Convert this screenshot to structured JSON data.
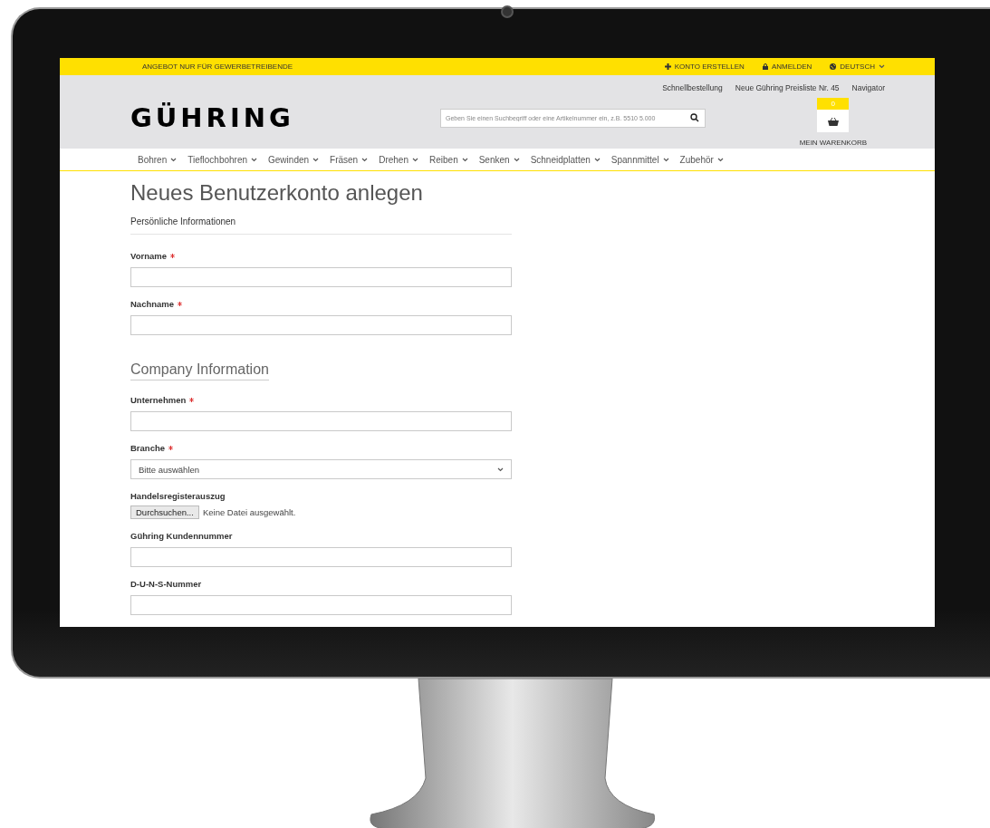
{
  "top_bar": {
    "notice": "ANGEBOT NUR FÜR GEWERBETREIBENDE",
    "links": [
      {
        "kind": "plus",
        "label": "KONTO ERSTELLEN"
      },
      {
        "kind": "lock",
        "label": "ANMELDEN"
      },
      {
        "kind": "language",
        "label": "DEUTSCH"
      }
    ]
  },
  "header": {
    "logo": "GÜHRING",
    "links": [
      "Schnellbestellung",
      "Neue Gühring Preisliste Nr. 45",
      "Navigator"
    ],
    "search": {
      "placeholder": "Geben Sie einen Suchbegriff oder eine Artikelnummer ein, z.B. 5510 5.000"
    },
    "cart": {
      "count": "0",
      "label": "MEIN WARENKORB"
    }
  },
  "nav": [
    "Bohren",
    "Tieflochbohren",
    "Gewinden",
    "Fräsen",
    "Drehen",
    "Reiben",
    "Senken",
    "Schneidplatten",
    "Spannmittel",
    "Zubehör"
  ],
  "form": {
    "title": "Neues Benutzerkonto anlegen",
    "items": [
      {
        "kind": "subheading",
        "text": "Persönliche Informationen"
      },
      {
        "kind": "text",
        "label": "Vorname",
        "required": true
      },
      {
        "kind": "text",
        "label": "Nachname",
        "required": true
      },
      {
        "kind": "heading",
        "text": "Company Information"
      },
      {
        "kind": "text",
        "label": "Unternehmen",
        "required": true
      },
      {
        "kind": "select",
        "label": "Branche",
        "required": true,
        "value": "Bitte auswählen"
      },
      {
        "kind": "file",
        "label": "Handelsregisterauszug",
        "required": false,
        "button": "Durchsuchen...",
        "status": "Keine Datei ausgewählt."
      },
      {
        "kind": "text",
        "label": "Gühring Kundennummer",
        "required": false
      },
      {
        "kind": "text",
        "label": "D-U-N-S-Nummer",
        "required": false
      }
    ]
  }
}
